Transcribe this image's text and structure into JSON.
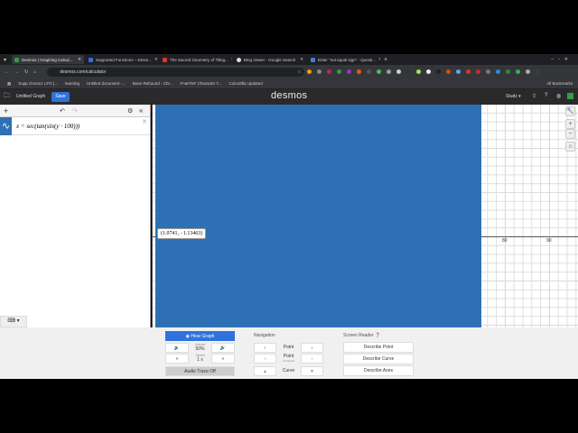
{
  "browser": {
    "tabs": [
      {
        "title": "Desmos | Graphing Calcul...",
        "color": "#2f9e44",
        "active": true
      },
      {
        "title": "Supported Functions – Desm...",
        "color": "#2f72dc"
      },
      {
        "title": "The Sacred Geometry of Tiling...",
        "color": "#e03131"
      },
      {
        "title": "Bing viewer - Google Search",
        "color": "#dddddd"
      },
      {
        "title": "Enter \"not equal sign\" - Questi...",
        "color": "#4a7bd0"
      }
    ],
    "url": "desmos.com/calculator",
    "bookmarks": [
      "Supp chsom1 LFG |...",
      "learning",
      "Untitled document -...",
      "Bean Rebound - Chr...",
      "FnaF/NF Character T...",
      "ColorZilla Updated"
    ],
    "all_bookmarks": "All Bookmarks"
  },
  "desmos": {
    "graph_title": "Untitled Graph",
    "save": "Save",
    "logo": "desmos",
    "user": "Studz ▾",
    "expression": "x = sec(tan(sin(y · 100)))",
    "tooltip": "(1.0741, −1.13463)",
    "x_ticks": [
      "80",
      "90"
    ],
    "fill_color": "#2d70b3"
  },
  "audio": {
    "hear_graph": "Hear Graph",
    "volume_label": "Volume",
    "volume": "50%",
    "speed_label": "Speed",
    "speed": "1 x",
    "audio_trace": "Audio Trace Off",
    "navigation": "Navigation",
    "point": "Point",
    "poi": "Point",
    "poi_sub": "of interest",
    "curve": "Curve",
    "screen_reader": "Screen Reader",
    "describe_point": "Describe Point",
    "describe_curve": "Describe Curve",
    "describe_axes": "Describe Axes"
  }
}
